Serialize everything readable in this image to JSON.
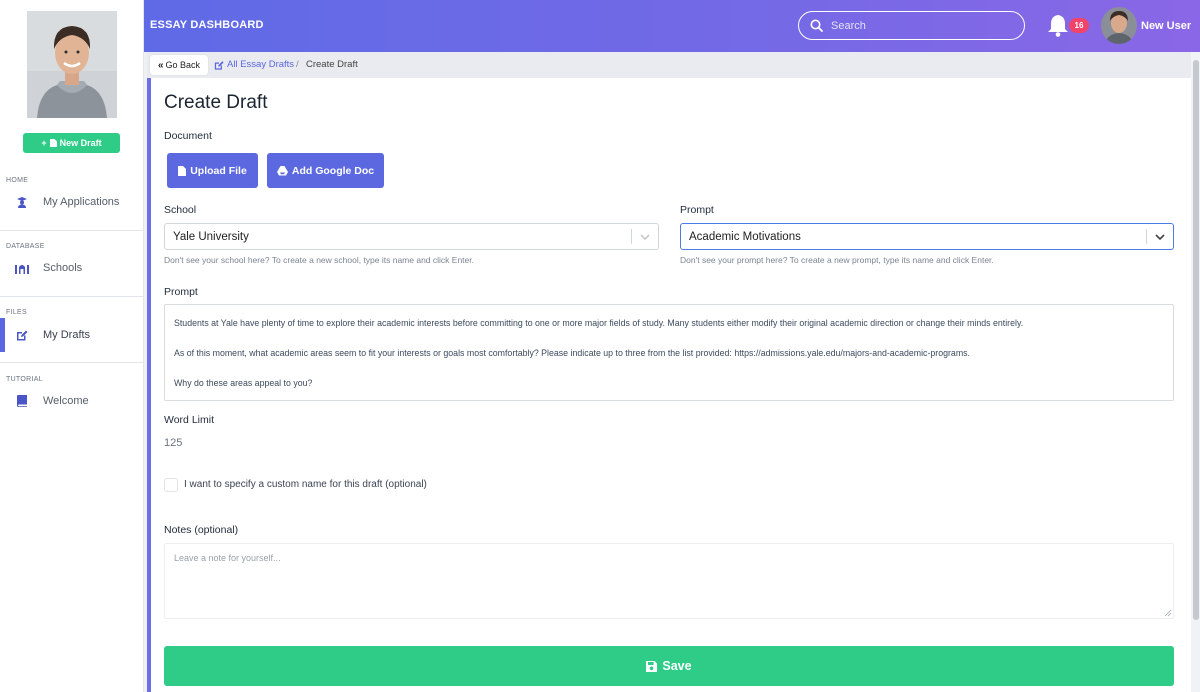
{
  "sidebar": {
    "new_draft_label": "New Draft",
    "sections": [
      {
        "label": "HOME",
        "item": "My Applications",
        "icon": "graduate-icon"
      },
      {
        "label": "DATABASE",
        "item": "Schools",
        "icon": "university-icon"
      },
      {
        "label": "FILES",
        "item": "My Drafts",
        "icon": "edit-icon",
        "active": true
      },
      {
        "label": "TUTORIAL",
        "item": "Welcome",
        "icon": "book-icon"
      }
    ]
  },
  "header": {
    "title": "ESSAY DASHBOARD",
    "search_placeholder": "Search",
    "notification_count": "16",
    "user_name": "New User"
  },
  "breadcrumb": {
    "back_label": "Go Back",
    "parent": "All Essay Drafts",
    "separator": "/",
    "current": "Create Draft"
  },
  "form": {
    "title": "Create Draft",
    "document_label": "Document",
    "upload_label": "Upload File",
    "google_doc_label": "Add Google Doc",
    "school_label": "School",
    "school_value": "Yale University",
    "school_hint": "Don't see your school here? To create a new school, type its name and click Enter.",
    "prompt_select_label": "Prompt",
    "prompt_select_value": "Academic Motivations",
    "prompt_hint": "Don't see your prompt here? To create a new prompt, type its name and click Enter.",
    "prompt_text_label": "Prompt",
    "prompt_paragraphs": [
      "Students at Yale have plenty of time to explore their academic interests before committing to one or more major fields of study. Many students either modify their original academic direction or change their minds entirely.",
      "As of this moment, what academic areas seem to fit your interests or goals most comfortably? Please indicate up to three from the list provided: https://admissions.yale.edu/majors-and-academic-programs.",
      "Why do these areas appeal to you?"
    ],
    "word_limit_label": "Word Limit",
    "word_limit_value": "125",
    "custom_name_label": "I want to specify a custom name for this draft (optional)",
    "notes_label": "Notes (optional)",
    "notes_placeholder": "Leave a note for yourself...",
    "save_label": "Save"
  },
  "colors": {
    "accent": "#5b67e0",
    "success": "#2ecc87",
    "badge": "#f0446a"
  }
}
